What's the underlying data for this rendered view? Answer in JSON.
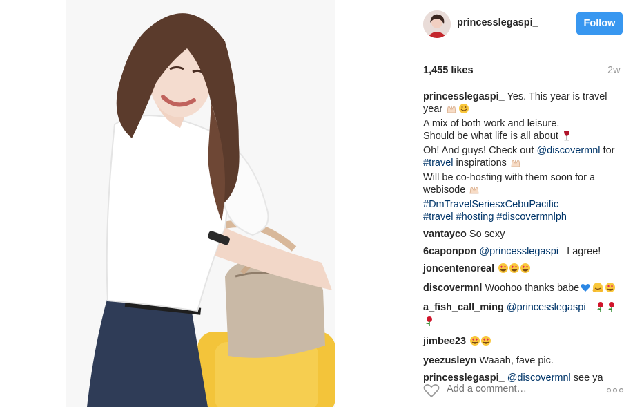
{
  "post": {
    "author": "princesslegaspi_",
    "follow_label": "Follow",
    "likes": "1,455 likes",
    "time_ago": "2w",
    "caption": {
      "user": "princesslegaspi_",
      "line1": " Yes. This year is travel year",
      "line2": "A mix of both work and leisure.",
      "line3": "Should be what life is all about",
      "line4a": "Oh! And guys! Check out ",
      "line4_mention": "@discovermnl",
      "line4b": " for",
      "line5_tag": "#travel",
      "line5b": " inspirations",
      "line6": "Will be co-hosting with them soon for a webisode",
      "tag_series": "#DmTravelSeriesxCebuPacific",
      "tag1": "#travel",
      "tag2": "#hosting",
      "tag3": "#discovermnlph"
    },
    "comments": [
      {
        "user": "vantayco",
        "text": " So sexy"
      },
      {
        "user": "6caponpon",
        "mention": "@princesslegaspi_",
        "text": " I agree!"
      },
      {
        "user": "joncentenoreal",
        "text": ""
      },
      {
        "user": "discovermnl",
        "text": " Woohoo thanks babe"
      },
      {
        "user": "a_fish_call_ming",
        "mention": "@princesslegaspi_",
        "text": ""
      },
      {
        "user": "jimbee23",
        "text": ""
      },
      {
        "user": "yeezusleyn",
        "text": " Waaah, fave pic."
      },
      {
        "user": "princesslegaspi_",
        "mention": "@discovermnl",
        "text": " see ya"
      }
    ],
    "add_comment_placeholder": "Add a comment…"
  },
  "colors": {
    "link": "#003569",
    "follow_button": "#3897f0",
    "muted": "#999999"
  },
  "icons": [
    "heart-outline-icon",
    "more-options-icon",
    "hands-emoji",
    "wine-glass-emoji",
    "heart-eyes-emoji",
    "blue-heart-emoji",
    "rose-emoji"
  ]
}
